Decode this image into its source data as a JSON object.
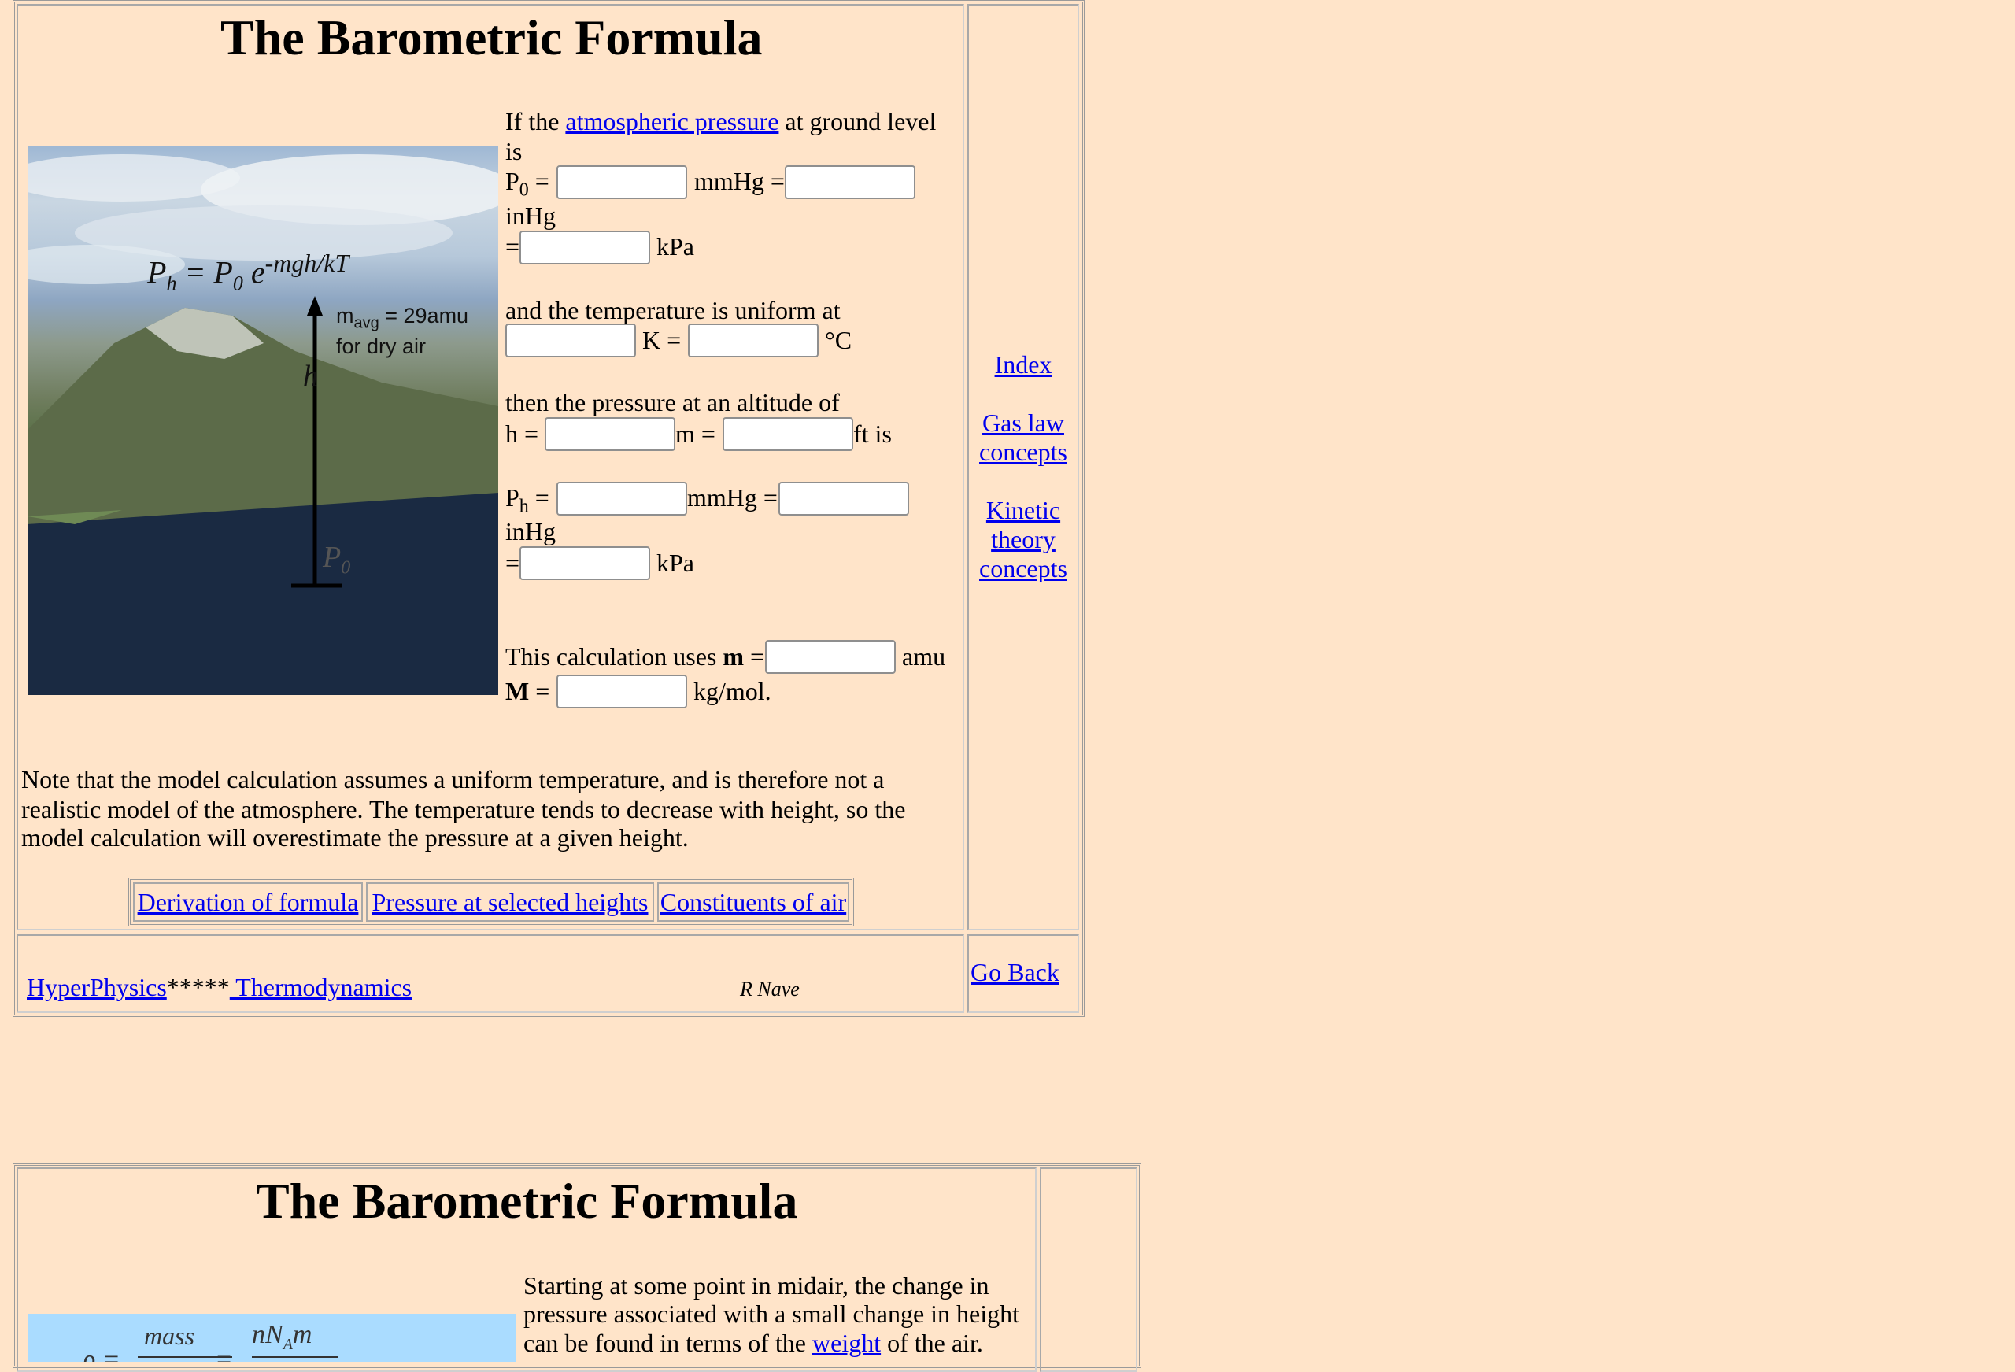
{
  "section1": {
    "title": "The Barometric Formula",
    "figure": {
      "formula_lhs": "P",
      "formula_lhs_sub": "h",
      "formula_mid": " = P",
      "formula_mid_sub": "0",
      "formula_e": " e",
      "formula_exp": "-mgh/kT",
      "mavg_line1": "m",
      "mavg_sub": "avg",
      "mavg_rest": " = 29amu",
      "mavg_line2": "for dry air",
      "h_label": "h",
      "p0_label": "P",
      "p0_sub": "0"
    },
    "intro_prefix": "If the ",
    "intro_link": "atmospheric pressure",
    "intro_suffix": " at ground level",
    "intro_is": "is",
    "p0_label": "P",
    "p0_sub": "0",
    "eq": " =",
    "unit_mmhg": "mmHg",
    "unit_inhg": "inHg",
    "unit_kpa": "kPa",
    "temp_text": "and the temperature is uniform at",
    "unit_k": "K =",
    "unit_c": "°C",
    "altitude_text": "then the pressure at an altitude of",
    "h_label": "h =",
    "unit_m": "m =",
    "unit_ft_is": "ft is",
    "ph_label": "P",
    "ph_sub": "h",
    "calc_text": "This calculation uses ",
    "calc_m": "m",
    "unit_amu": "amu",
    "calc_M": "M",
    "unit_kgmol": "kg/mol.",
    "note_line1": "Note that the model calculation assumes a uniform temperature, and is therefore not a",
    "note_line2": "realistic model of the atmosphere. The temperature tends to decrease with height, so the",
    "note_line3": "model calculation will overestimate the pressure at a given height.",
    "bottom_links": [
      "Derivation of formula",
      "Pressure at selected heights",
      "Constituents of air"
    ],
    "side_links": {
      "index": "Index",
      "gas_law_1": "Gas law",
      "gas_law_2": "concepts",
      "kinetic_1": "Kinetic",
      "kinetic_2": "theory",
      "kinetic_3": "concepts"
    },
    "footer": {
      "hyperphysics": "HyperPhysics",
      "stars": "*****",
      "thermo": " Thermodynamics",
      "author": "R Nave",
      "go_back": "Go Back"
    }
  },
  "section2": {
    "title": "The Barometric Formula",
    "text_line1": "Starting at some point in midair, the change in",
    "text_line2": "pressure associated with a small change in height",
    "text_line3_prefix": "can be found in terms of the ",
    "text_link": "weight",
    "text_line3_suffix": " of the air.",
    "figure": {
      "rho": "ρ =",
      "mass": "mass",
      "eq": "=",
      "nnam": "nN",
      "nnam_sub": "A",
      "nnam_m": "m"
    }
  }
}
